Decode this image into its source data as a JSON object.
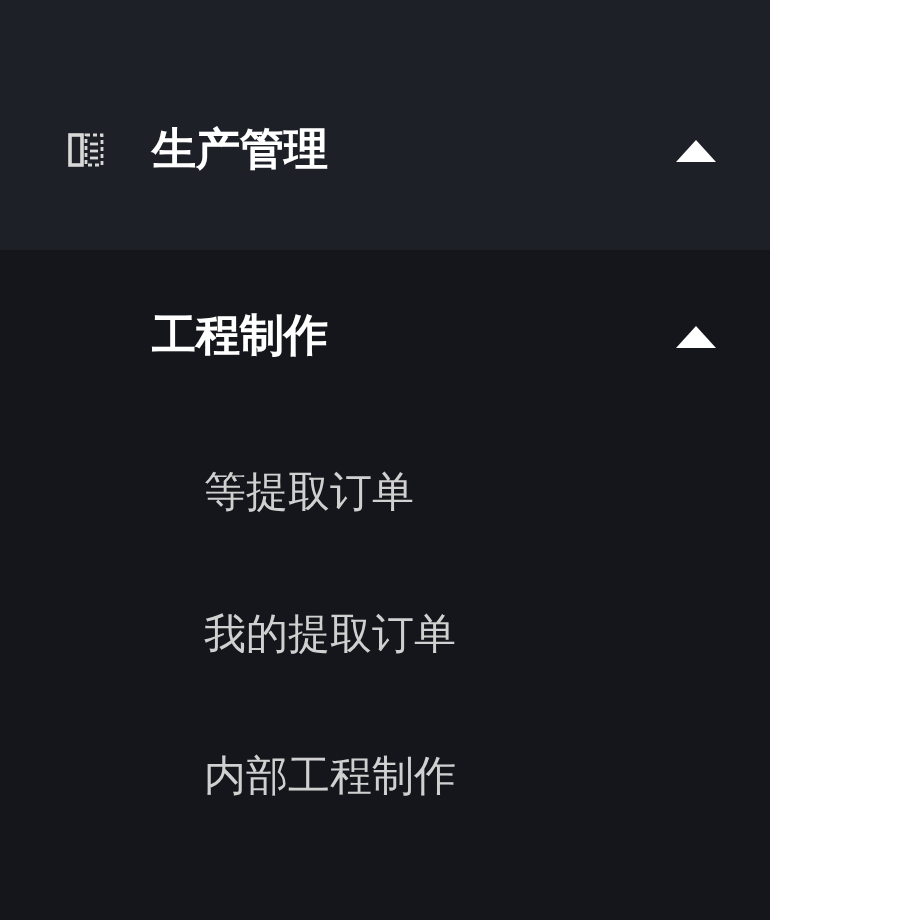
{
  "menu": {
    "label": "生产管理",
    "expanded": true,
    "submenu": {
      "label": "工程制作",
      "expanded": true,
      "items": [
        {
          "label": "等提取订单"
        },
        {
          "label": "我的提取订单"
        },
        {
          "label": "内部工程制作"
        }
      ]
    }
  }
}
